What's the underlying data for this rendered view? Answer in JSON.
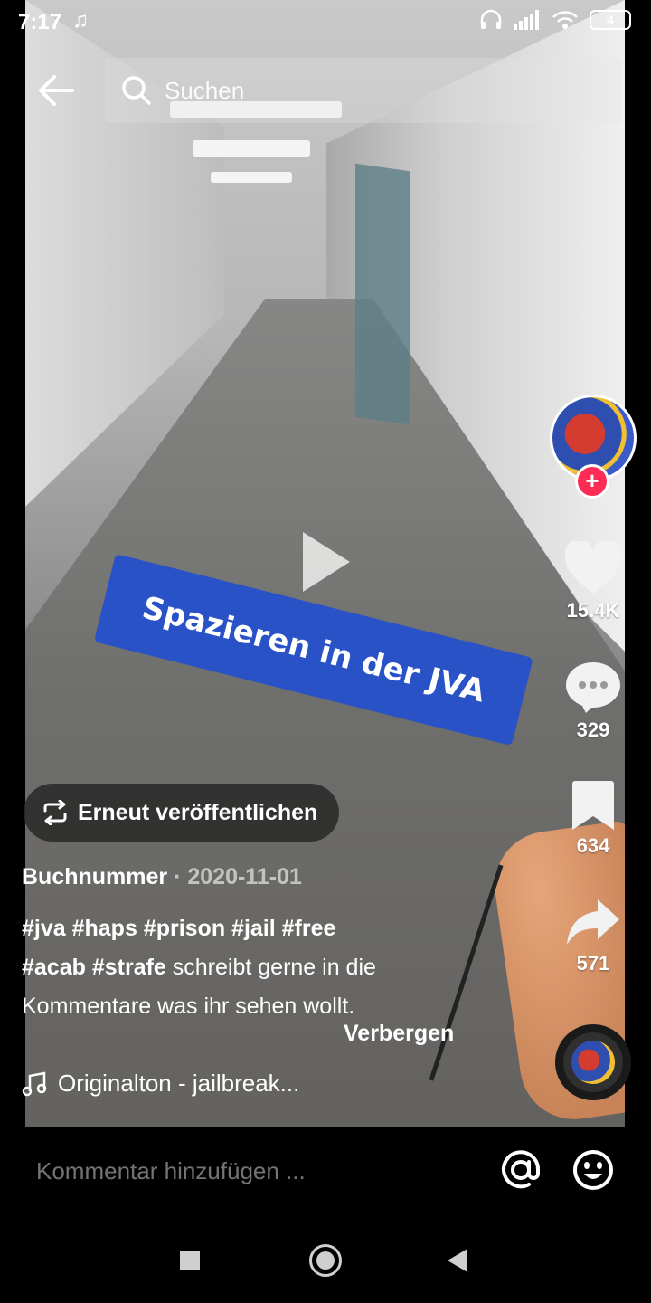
{
  "status_bar": {
    "time": "7:17",
    "battery": "4"
  },
  "search": {
    "placeholder": "Suchen"
  },
  "video": {
    "overlay_text": "Spazieren in der JVA"
  },
  "actions": {
    "likes": "15.4K",
    "comments": "329",
    "favorites": "634",
    "shares": "571"
  },
  "repost": {
    "label": "Erneut veröffentlichen"
  },
  "post": {
    "author": "Buchnummer",
    "separator": " · ",
    "date": "2020-11-01",
    "hashtags_line1": "#jva #haps #prison #jail #free",
    "hashtags_line2": "#acab #strafe",
    "caption_rest": " schreibt gerne in die",
    "caption_line3": "Kommentare was ihr sehen wollt.",
    "hide_label": "Verbergen"
  },
  "sound": {
    "label": "Originalton - jailbreak..."
  },
  "comment": {
    "placeholder": "Kommentar hinzufügen ..."
  },
  "icons": {
    "back": "arrow-left-icon",
    "search": "search-icon",
    "like": "heart-icon",
    "comment": "comment-bubble-icon",
    "favorite": "bookmark-icon",
    "share": "share-arrow-icon",
    "repost": "repost-icon",
    "music": "music-note-icon",
    "mention": "at-icon",
    "emoji": "emoji-icon"
  },
  "colors": {
    "accent": "#fe2c55",
    "sticker": "#2a52c7",
    "background": "#000000"
  }
}
